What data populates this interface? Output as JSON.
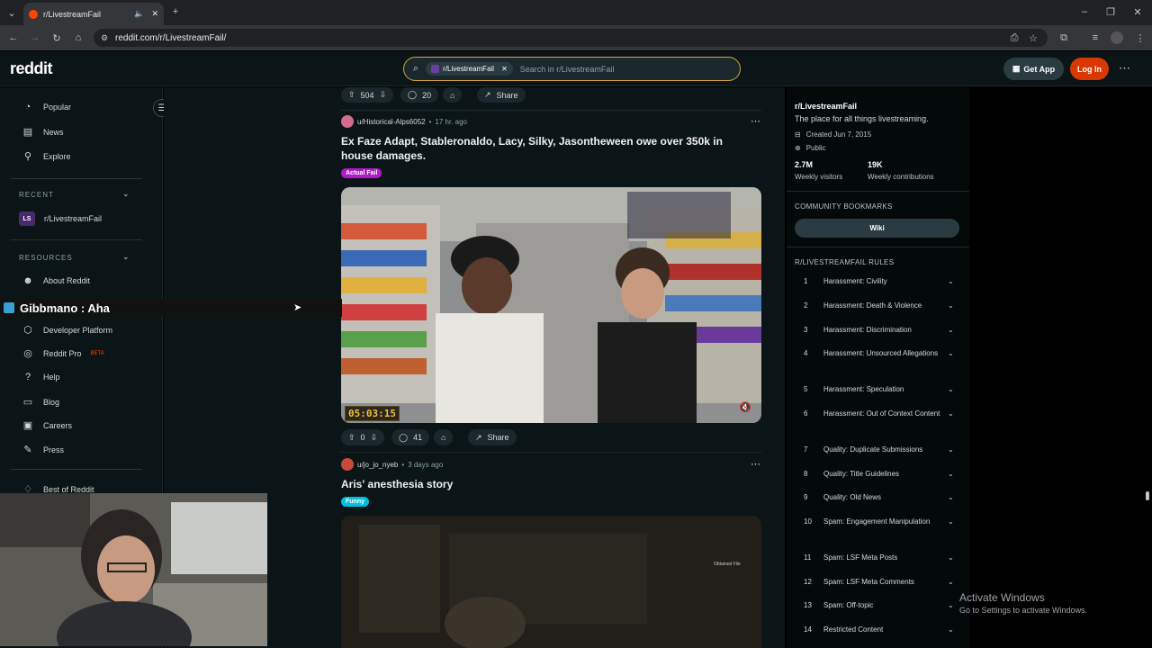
{
  "browser": {
    "tab_title": "r/LivestreamFail",
    "url": "reddit.com/r/LivestreamFail/"
  },
  "header": {
    "logo": "reddit",
    "search_chip": "r/LivestreamFail",
    "search_placeholder": "Search in r/LivestreamFail",
    "get_app": "Get App",
    "login": "Log In"
  },
  "sidebar": {
    "items": [
      "Popular",
      "News",
      "Explore"
    ],
    "recent_label": "RECENT",
    "recent_items": [
      "r/LivestreamFail"
    ],
    "resources_label": "RESOURCES",
    "resources_items": [
      "About Reddit",
      "Developer Platform",
      "Reddit Pro",
      "Help",
      "Blog",
      "Careers",
      "Press",
      "Best of Reddit"
    ],
    "pro_badge": "BETA"
  },
  "overlay": {
    "text": "Gibbmano : Aha"
  },
  "feed": {
    "top_bar": {
      "votes": "504",
      "comments": "20",
      "share": "Share"
    },
    "posts": [
      {
        "author": "u/Historical-Alps6052",
        "time": "17 hr. ago",
        "title": "Ex Faze Adapt, Stableronaldo, Lacy, Silky, Jasontheween owe over 350k in house damages.",
        "flair": "Actual Fail",
        "video_timer": "05:03:15",
        "votes": "0",
        "comments": "41",
        "share": "Share"
      },
      {
        "author": "u/jo_jo_nyeb",
        "time": "3 days ago",
        "title": "Aris' anesthesia story",
        "flair": "Funny",
        "video_caption": "Obtained File"
      }
    ]
  },
  "community": {
    "name": "r/LivestreamFail",
    "description": "The place for all things livestreaming.",
    "created": "Created Jun 7, 2015",
    "visibility": "Public",
    "visitors_value": "2.7M",
    "visitors_label": "Weekly visitors",
    "contrib_value": "19K",
    "contrib_label": "Weekly contributions",
    "bookmarks_label": "COMMUNITY BOOKMARKS",
    "wiki": "Wiki",
    "rules_label": "R/LIVESTREAMFAIL RULES",
    "rules": [
      "Harassment: Civility",
      "Harassment: Death & Violence",
      "Harassment: Discrimination",
      "Harassment: Unsourced Allegations",
      "Harassment: Speculation",
      "Harassment: Out of Context Content",
      "Quality: Duplicate Submissions",
      "Quality: Title Guidelines",
      "Quality: Old News",
      "Spam: Engagement Manipulation",
      "Spam: LSF Meta Posts",
      "Spam: LSF Meta Comments",
      "Spam: Off-topic",
      "Restricted Content"
    ]
  },
  "watermark": {
    "line1": "Activate Windows",
    "line2": "Go to Settings to activate Windows."
  },
  "colors": {
    "accent": "#d93900",
    "search_border": "#d7a43a",
    "flair_actual_fail": "#b01ac9",
    "flair_funny": "#00c0e0"
  }
}
